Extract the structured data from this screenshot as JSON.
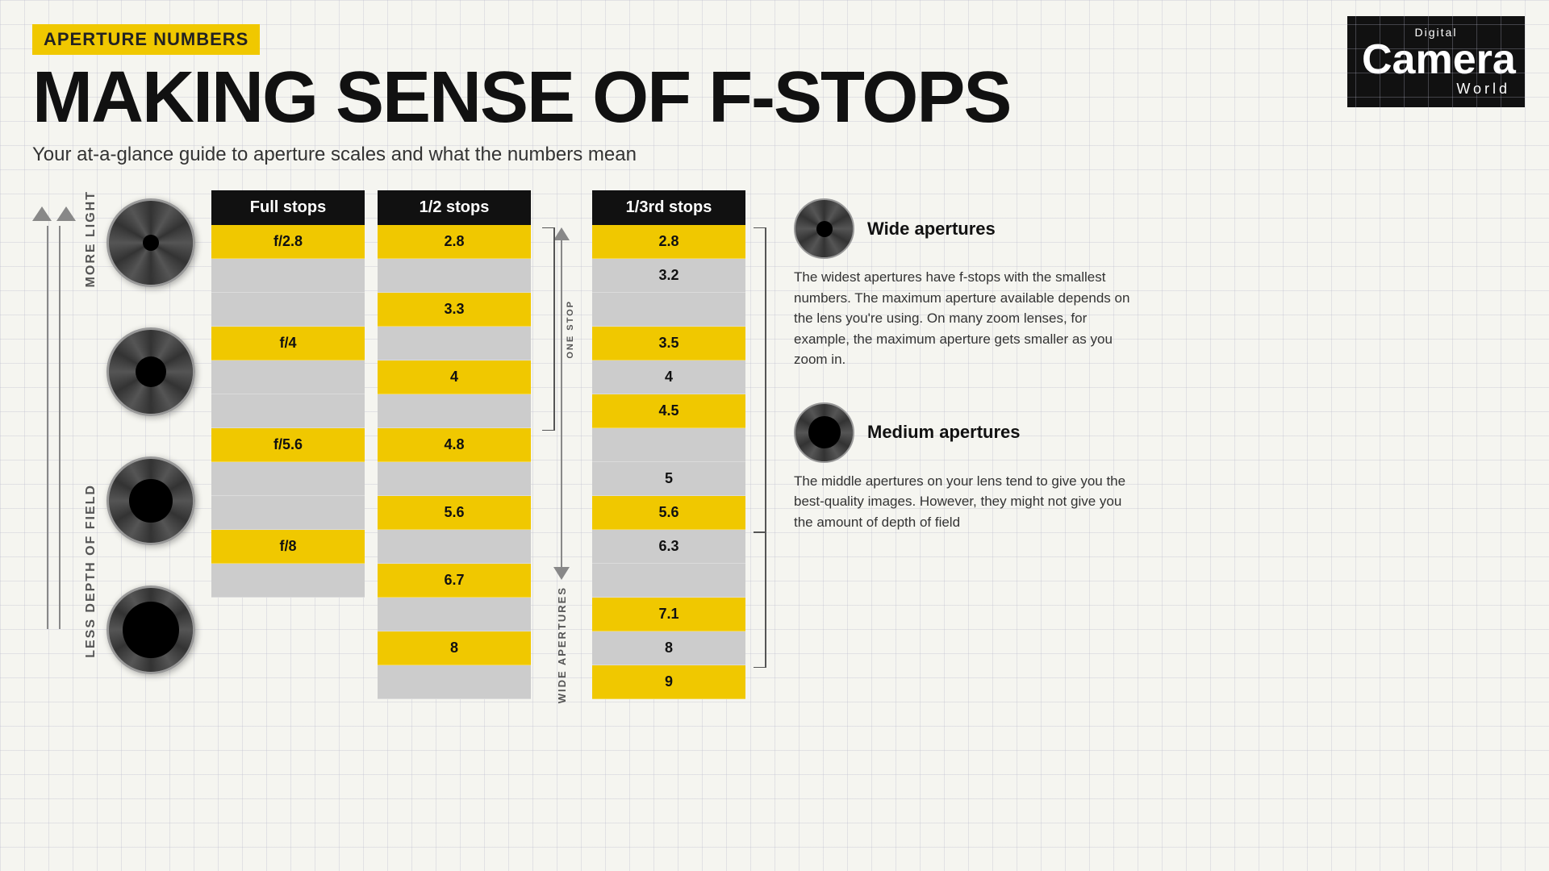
{
  "badge": "Aperture Numbers",
  "title": "MAKING SENSE OF F-STOPS",
  "subtitle": "Your at-a-glance guide to aperture scales and what the numbers mean",
  "logo": {
    "digital": "Digital",
    "camera": "Camera",
    "world": "World"
  },
  "full_stops": {
    "header": "Full stops",
    "rows": [
      {
        "value": "f/2.8",
        "type": "yellow"
      },
      {
        "value": "",
        "type": "gray"
      },
      {
        "value": "",
        "type": "gray"
      },
      {
        "value": "f/4",
        "type": "yellow"
      },
      {
        "value": "",
        "type": "gray"
      },
      {
        "value": "",
        "type": "gray"
      },
      {
        "value": "f/5.6",
        "type": "yellow"
      },
      {
        "value": "",
        "type": "gray"
      },
      {
        "value": "",
        "type": "gray"
      },
      {
        "value": "f/8",
        "type": "yellow"
      },
      {
        "value": "",
        "type": "gray"
      }
    ]
  },
  "half_stops": {
    "header": "1/2 stops",
    "rows": [
      {
        "value": "2.8",
        "type": "yellow"
      },
      {
        "value": "",
        "type": "gray"
      },
      {
        "value": "3.3",
        "type": "yellow"
      },
      {
        "value": "",
        "type": "gray"
      },
      {
        "value": "4",
        "type": "yellow"
      },
      {
        "value": "",
        "type": "gray"
      },
      {
        "value": "4.8",
        "type": "yellow"
      },
      {
        "value": "",
        "type": "gray"
      },
      {
        "value": "5.6",
        "type": "yellow"
      },
      {
        "value": "",
        "type": "gray"
      },
      {
        "value": "6.7",
        "type": "yellow"
      },
      {
        "value": "",
        "type": "gray"
      },
      {
        "value": "8",
        "type": "yellow"
      },
      {
        "value": "",
        "type": "gray"
      }
    ]
  },
  "third_stops": {
    "header": "1/3rd stops",
    "rows": [
      {
        "value": "2.8",
        "type": "yellow"
      },
      {
        "value": "3.2",
        "type": "gray"
      },
      {
        "value": "",
        "type": "gray"
      },
      {
        "value": "3.5",
        "type": "yellow"
      },
      {
        "value": "4",
        "type": "gray"
      },
      {
        "value": "4.5",
        "type": "yellow"
      },
      {
        "value": "",
        "type": "gray"
      },
      {
        "value": "5",
        "type": "gray"
      },
      {
        "value": "5.6",
        "type": "yellow"
      },
      {
        "value": "6.3",
        "type": "gray"
      },
      {
        "value": "",
        "type": "gray"
      },
      {
        "value": "7.1",
        "type": "yellow"
      },
      {
        "value": "8",
        "type": "gray"
      },
      {
        "value": "9",
        "type": "yellow"
      }
    ]
  },
  "wide_apertures": {
    "label": "WIDE APERTURES",
    "title": "Wide apertures",
    "text": "The widest apertures have f-stops with the smallest numbers. The maximum aperture available depends on the lens you're using. On many zoom lenses, for example, the maximum aperture gets smaller as you zoom in."
  },
  "medium_apertures": {
    "label": "Medium apertures",
    "title": "Medium apertures",
    "text": "The middle apertures on your lens tend to give you the best-quality images. However, they might not give you the amount of depth of field"
  },
  "one_stop_label": "ONE STOP",
  "side_labels": {
    "top": "MORE LIGHT",
    "bottom": "LESS DEPTH OF FIELD"
  },
  "apertures": [
    {
      "size": 20
    },
    {
      "size": 35
    },
    {
      "size": 50
    },
    {
      "size": 65
    }
  ]
}
